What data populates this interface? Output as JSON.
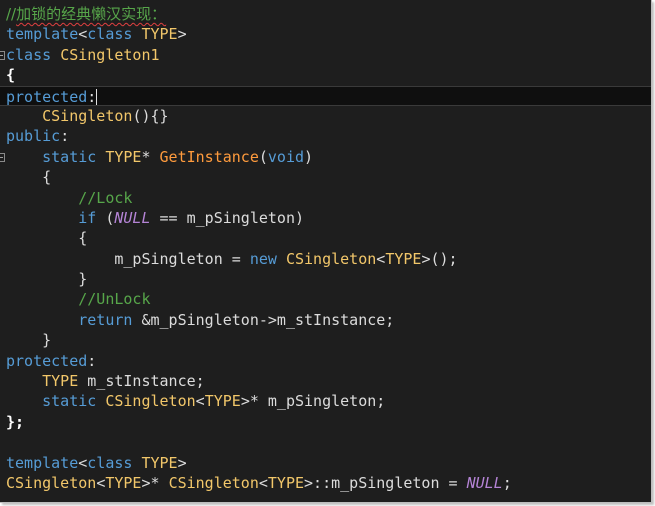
{
  "editor": {
    "lines": [
      {
        "fold": false,
        "tokens": [
          {
            "c": "cm-title",
            "t": "//"
          },
          {
            "c": "cm-title squiggle",
            "t": "加锁的经典懒汉实现："
          }
        ]
      },
      {
        "fold": false,
        "tokens": [
          {
            "c": "k",
            "t": "template"
          },
          {
            "c": "p",
            "t": "<"
          },
          {
            "c": "k",
            "t": "class"
          },
          {
            "c": "p",
            "t": " "
          },
          {
            "c": "t",
            "t": "TYPE"
          },
          {
            "c": "p",
            "t": ">"
          }
        ]
      },
      {
        "fold": true,
        "tokens": [
          {
            "c": "k",
            "t": "class"
          },
          {
            "c": "p",
            "t": " "
          },
          {
            "c": "t",
            "t": "CSingleton1"
          }
        ]
      },
      {
        "fold": false,
        "tokens": [
          {
            "c": "b",
            "t": "{"
          }
        ]
      },
      {
        "fold": false,
        "current": true,
        "cursor": true,
        "tokens": [
          {
            "c": "k",
            "t": "protected"
          },
          {
            "c": "p",
            "t": ":"
          }
        ]
      },
      {
        "fold": false,
        "tokens": [
          {
            "c": "p",
            "t": "    "
          },
          {
            "c": "t",
            "t": "CSingleton"
          },
          {
            "c": "p",
            "t": "(){}"
          }
        ]
      },
      {
        "fold": false,
        "tokens": [
          {
            "c": "k",
            "t": "public"
          },
          {
            "c": "p",
            "t": ":"
          }
        ]
      },
      {
        "fold": true,
        "tokens": [
          {
            "c": "p",
            "t": "    "
          },
          {
            "c": "k",
            "t": "static"
          },
          {
            "c": "p",
            "t": " "
          },
          {
            "c": "t",
            "t": "TYPE"
          },
          {
            "c": "p",
            "t": "* "
          },
          {
            "c": "f",
            "t": "GetInstance"
          },
          {
            "c": "p",
            "t": "("
          },
          {
            "c": "k",
            "t": "void"
          },
          {
            "c": "p",
            "t": ")"
          }
        ]
      },
      {
        "fold": false,
        "tokens": [
          {
            "c": "p",
            "t": "    {"
          }
        ]
      },
      {
        "fold": false,
        "tokens": [
          {
            "c": "p",
            "t": "        "
          },
          {
            "c": "c",
            "t": "//Lock"
          }
        ]
      },
      {
        "fold": false,
        "tokens": [
          {
            "c": "p",
            "t": "        "
          },
          {
            "c": "k",
            "t": "if"
          },
          {
            "c": "p",
            "t": " ("
          },
          {
            "c": "n",
            "t": "NULL"
          },
          {
            "c": "p",
            "t": " == m_pSingleton)"
          }
        ]
      },
      {
        "fold": false,
        "tokens": [
          {
            "c": "p",
            "t": "        {"
          }
        ]
      },
      {
        "fold": false,
        "tokens": [
          {
            "c": "p",
            "t": "            m_pSingleton = "
          },
          {
            "c": "k",
            "t": "new"
          },
          {
            "c": "p",
            "t": " "
          },
          {
            "c": "t",
            "t": "CSingleton"
          },
          {
            "c": "p",
            "t": "<"
          },
          {
            "c": "t",
            "t": "TYPE"
          },
          {
            "c": "p",
            "t": ">();"
          }
        ]
      },
      {
        "fold": false,
        "tokens": [
          {
            "c": "p",
            "t": "        }"
          }
        ]
      },
      {
        "fold": false,
        "tokens": [
          {
            "c": "p",
            "t": "        "
          },
          {
            "c": "c",
            "t": "//UnLock"
          }
        ]
      },
      {
        "fold": false,
        "tokens": [
          {
            "c": "p",
            "t": "        "
          },
          {
            "c": "k",
            "t": "return"
          },
          {
            "c": "p",
            "t": " &m_pSingleton->m_stInstance;"
          }
        ]
      },
      {
        "fold": false,
        "tokens": [
          {
            "c": "p",
            "t": "    }"
          }
        ]
      },
      {
        "fold": false,
        "tokens": [
          {
            "c": "k",
            "t": "protected"
          },
          {
            "c": "p",
            "t": ":"
          }
        ]
      },
      {
        "fold": false,
        "tokens": [
          {
            "c": "p",
            "t": "    "
          },
          {
            "c": "t",
            "t": "TYPE"
          },
          {
            "c": "p",
            "t": " m_stInstance;"
          }
        ]
      },
      {
        "fold": false,
        "tokens": [
          {
            "c": "p",
            "t": "    "
          },
          {
            "c": "k",
            "t": "static"
          },
          {
            "c": "p",
            "t": " "
          },
          {
            "c": "t",
            "t": "CSingleton"
          },
          {
            "c": "p",
            "t": "<"
          },
          {
            "c": "t",
            "t": "TYPE"
          },
          {
            "c": "p",
            "t": ">* m_pSingleton;"
          }
        ]
      },
      {
        "fold": false,
        "tokens": [
          {
            "c": "b",
            "t": "};"
          }
        ]
      },
      {
        "fold": false,
        "tokens": []
      },
      {
        "fold": false,
        "tokens": [
          {
            "c": "k",
            "t": "template"
          },
          {
            "c": "p",
            "t": "<"
          },
          {
            "c": "k",
            "t": "class"
          },
          {
            "c": "p",
            "t": " "
          },
          {
            "c": "t",
            "t": "TYPE"
          },
          {
            "c": "p",
            "t": ">"
          }
        ]
      },
      {
        "fold": false,
        "tokens": [
          {
            "c": "t",
            "t": "CSingleton"
          },
          {
            "c": "p",
            "t": "<"
          },
          {
            "c": "t",
            "t": "TYPE"
          },
          {
            "c": "p",
            "t": ">* "
          },
          {
            "c": "t",
            "t": "CSingleton"
          },
          {
            "c": "p",
            "t": "<"
          },
          {
            "c": "t",
            "t": "TYPE"
          },
          {
            "c": "p",
            "t": ">::m_pSingleton = "
          },
          {
            "c": "n",
            "t": "NULL"
          },
          {
            "c": "p",
            "t": ";"
          }
        ]
      }
    ]
  },
  "colors": {
    "background": "#1e1e1e",
    "keyword": "#569cd6",
    "type": "#f2c76a",
    "function": "#ff9b3d",
    "comment": "#57a64a",
    "macro": "#b584d6",
    "plain": "#dcdcdc"
  }
}
